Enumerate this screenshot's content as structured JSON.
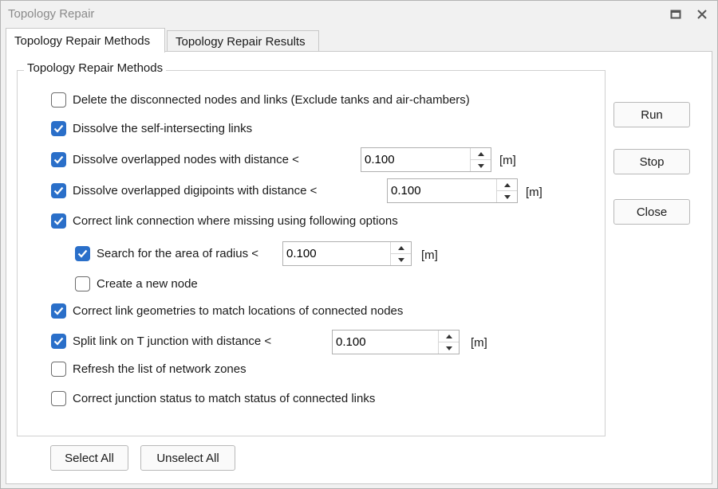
{
  "window": {
    "title": "Topology Repair"
  },
  "tabs": [
    {
      "label": "Topology Repair Methods",
      "active": true
    },
    {
      "label": "Topology Repair Results",
      "active": false
    }
  ],
  "group": {
    "title": "Topology Repair Methods"
  },
  "options": {
    "delete_disconnected": {
      "label": "Delete the disconnected nodes and links (Exclude tanks and air-chambers)",
      "checked": false
    },
    "dissolve_self_intersecting": {
      "label": "Dissolve the self-intersecting links",
      "checked": true
    },
    "dissolve_overlapped_nodes": {
      "label": "Dissolve overlapped nodes with distance <",
      "checked": true,
      "value": "0.100",
      "unit": "[m]"
    },
    "dissolve_overlapped_digipoints": {
      "label": "Dissolve overlapped digipoints with distance <",
      "checked": true,
      "value": "0.100",
      "unit": "[m]"
    },
    "correct_link_connection": {
      "label": "Correct link connection where missing using following options",
      "checked": true
    },
    "search_radius": {
      "label": "Search for the area of radius <",
      "checked": true,
      "value": "0.100",
      "unit": "[m]"
    },
    "create_new_node": {
      "label": "Create a new node",
      "checked": false
    },
    "correct_link_geometries": {
      "label": "Correct link geometries to match locations of connected nodes",
      "checked": true
    },
    "split_link_t_junction": {
      "label": "Split link on T junction with distance <",
      "checked": true,
      "value": "0.100",
      "unit": "[m]"
    },
    "refresh_network_zones": {
      "label": "Refresh the list of network zones",
      "checked": false
    },
    "correct_junction_status": {
      "label": "Correct junction status to match status of connected links",
      "checked": false
    }
  },
  "buttons": {
    "run": "Run",
    "stop": "Stop",
    "close": "Close",
    "select_all": "Select All",
    "unselect_all": "Unselect All"
  },
  "colors": {
    "accent": "#2a6fc9",
    "title_text": "#8a8a8a"
  }
}
